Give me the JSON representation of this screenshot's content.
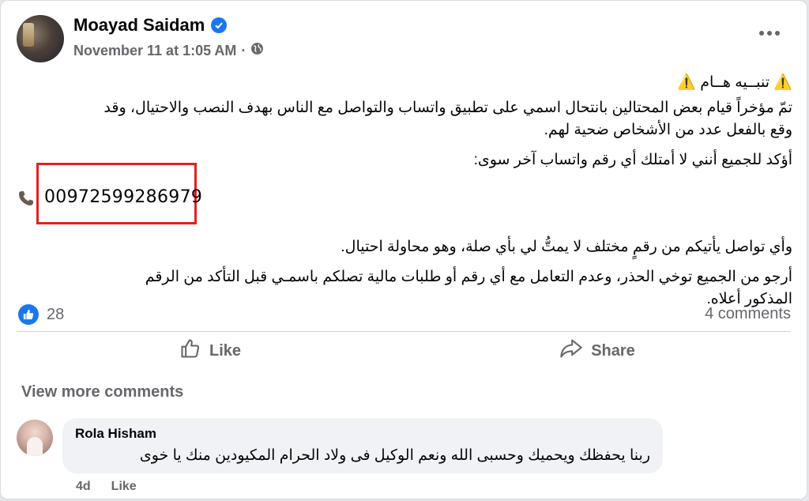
{
  "post": {
    "author": "Moayad Saidam",
    "timestamp": "November 11 at 1:05 AM",
    "separator": "·",
    "title_line": "⚠️ تنبــيه هــام ⚠️",
    "paragraph_1_line_1": "تمّ مؤخراً قيام بعض المحتالين بانتحال اسمي على تطبيق واتساب والتواصل مع الناس بهدف النصب والاحتيال، وقد",
    "paragraph_1_line_2": "وقع بالفعل عدد من الأشخاص ضحية لهم.",
    "paragraph_2": "أؤكد للجميع أنني لا أمتلك أي رقم واتساب آخر سوى:",
    "phone_number": "00972599286979",
    "paragraph_3": "وأي تواصل يأتيكم من رقمٍ مختلف لا يمتُّ لي بأي صلة، وهو محاولة احتيال.",
    "paragraph_4_line_1": "أرجو من الجميع توخي الحذر، وعدم التعامل مع أي رقم أو طلبات مالية تصلكم باسمـي قبل التأكد من الرقم",
    "paragraph_4_line_2": "المذكور أعلاه."
  },
  "reactions": {
    "like_count": "28",
    "comments_label": "4 comments"
  },
  "actions": {
    "like_label": "Like",
    "share_label": "Share"
  },
  "comments": {
    "view_more_label": "View more comments",
    "items": [
      {
        "author": "Rola Hisham",
        "text": "ربنا يحفظك ويحميك وحسبى الله ونعم الوكيل فى ولاد الحرام المكيودين منك يا خوى",
        "age": "4d",
        "like_label": "Like"
      }
    ]
  },
  "colors": {
    "brand_blue": "#1877f2",
    "highlight_red": "#e0231b",
    "muted_text": "#65676b"
  },
  "icons": {
    "verified": "verified-badge-icon",
    "audience": "globe-icon",
    "more": "more-options-icon",
    "phone": "phone-icon",
    "like_reaction": "like-reaction-icon",
    "like_action": "thumbs-up-icon",
    "share_action": "share-arrow-icon"
  }
}
